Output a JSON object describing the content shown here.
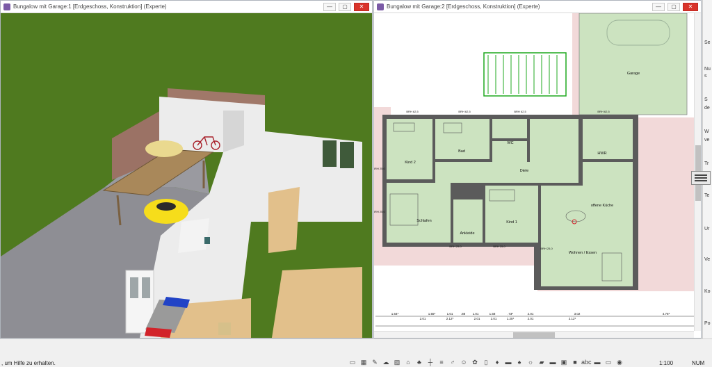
{
  "left_window": {
    "title": "Bungalow mit Garage:1 [Erdgeschoss, Konstruktion] (Experte)",
    "controls": {
      "minimize": "—",
      "maximize": "▢",
      "close": "✕"
    }
  },
  "right_window": {
    "title": "Bungalow mit Garage:2 [Erdgeschoss, Konstruktion] (Experte)",
    "controls": {
      "minimize": "—",
      "maximize": "▢",
      "close": "✕"
    },
    "rooms": [
      "Garage",
      "Kind 2",
      "Bad",
      "WC",
      "HWR",
      "Diele",
      "offene Küche",
      "Schlafen",
      "Ankleide",
      "Kind 1",
      "Wohnen / Essen"
    ],
    "window_labels": [
      "BRH 62,5",
      "BRH 62,5",
      "BRH 62,5",
      "BRH 62,5",
      "BRH 25,0",
      "BRH 25,0",
      "BRH 25,0",
      "BRH 25,0",
      "BRH 25,0"
    ],
    "dimensions_top": [
      "1.64⁵",
      "1.55⁵",
      "1.01",
      ".88",
      "1.01",
      "1.58",
      ".73⁵",
      "2.01",
      "3.02",
      "4.76⁵"
    ],
    "dimensions_bottom": [
      "2.01",
      "2.12⁵",
      "2.01",
      "2.01",
      "1.25⁵",
      "2.01",
      "2.12⁵"
    ]
  },
  "side_panel": {
    "items": [
      "Se",
      "Nu",
      "s",
      "S",
      "de",
      "W",
      "ve",
      "Tr",
      "Te",
      "Ur",
      "Ve",
      "Ko",
      "Po"
    ]
  },
  "statusbar": {
    "hint": ", um Hilfe zu erhalten.",
    "scale": "1:100",
    "mode": "NUM",
    "tool_icons": [
      "window-icon",
      "grid-icon",
      "pencil-icon",
      "cloud-icon",
      "landscape-icon",
      "roof-icon",
      "tree-icon",
      "fence-icon",
      "stairs-icon",
      "walk-icon",
      "person-icon",
      "plant-icon",
      "door-icon",
      "chair-icon",
      "sofa-icon",
      "bush-icon",
      "lamp-icon",
      "car-icon",
      "bed-icon",
      "tv-icon",
      "box-icon",
      "text-icon",
      "sofa2-icon",
      "bench-icon",
      "camera-icon"
    ],
    "tool_glyphs": [
      "▭",
      "▦",
      "✎",
      "☁",
      "▨",
      "⌂",
      "♣",
      "┼",
      "≡",
      "♂",
      "☺",
      "✿",
      "▯",
      "♦",
      "▬",
      "♠",
      "☼",
      "▰",
      "▬",
      "▣",
      "■",
      "abc",
      "▬",
      "▭",
      "◉"
    ]
  },
  "colors": {
    "grass": "#4f7a1f",
    "paving": "#8f8f95",
    "wall_3d": "#e8e8e8",
    "floor_wood": "#e2c08b",
    "plan_room": "#cce3c0",
    "plan_terrace": "#f2d9d9",
    "hedge": "#1fa81f",
    "car": "#f6dd1b"
  }
}
